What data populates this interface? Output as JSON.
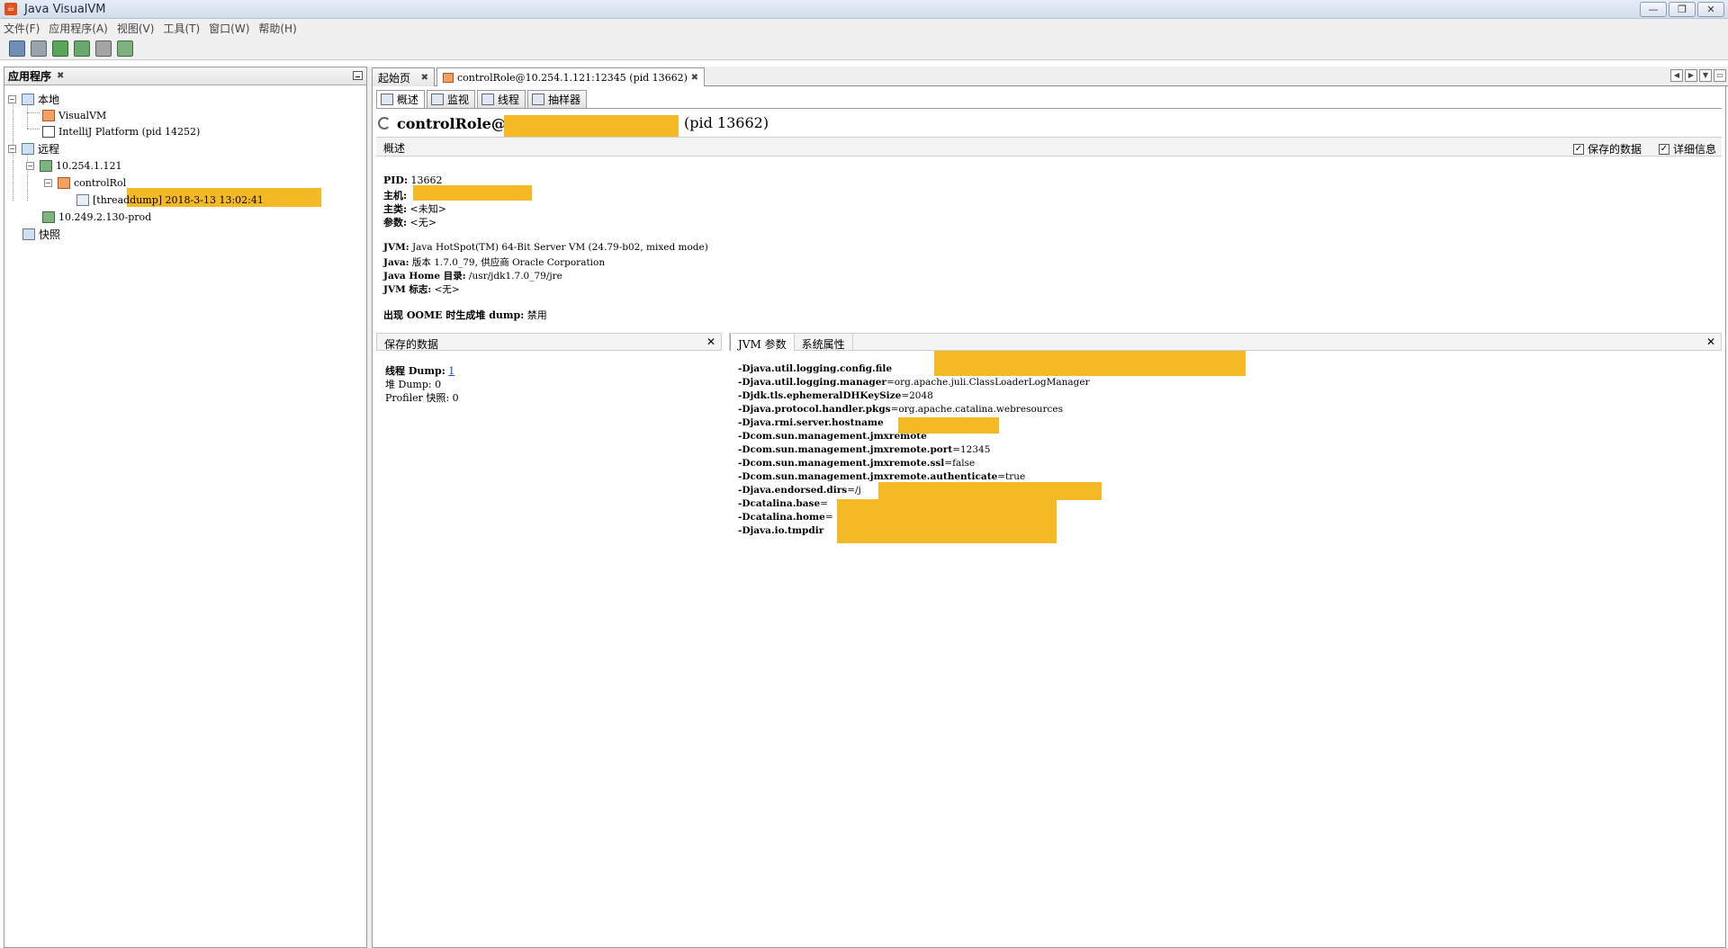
{
  "window": {
    "title": "Java VisualVM",
    "controls": [
      "—",
      "❐",
      "✕"
    ]
  },
  "menu": [
    "文件(F)",
    "应用程序(A)",
    "视图(V)",
    "工具(T)",
    "窗口(W)",
    "帮助(H)"
  ],
  "left_panel": {
    "title": "应用程序",
    "tree": {
      "local": "本地",
      "visualvm": "VisualVM",
      "intellij": "IntelliJ Platform (pid 14252)",
      "remote": "远程",
      "host1": "10.254.1.121",
      "control_role": "controlRol",
      "threaddump": "[threaddump] 2018-3-13 13:02:41",
      "host2": "10.249.2.130-prod",
      "snapshots": "快照"
    }
  },
  "doc_tabs": [
    {
      "label": "起始页"
    },
    {
      "label": "controlRole@10.254.1.121:12345 (pid 13662)"
    }
  ],
  "view_tabs": [
    "概述",
    "监视",
    "线程",
    "抽样器"
  ],
  "overview": {
    "title_prefix": "controlRole@",
    "title_pid": "(pid 13662)",
    "section_title": "概述",
    "checkbox_saved": "保存的数据",
    "checkbox_details": "详细信息",
    "lines": [
      {
        "key": "PID:",
        "value": " 13662"
      },
      {
        "key": "主机:",
        "value": ""
      },
      {
        "key": "主类:",
        "value": " <未知>"
      },
      {
        "key": "参数:",
        "value": " <无>"
      },
      {
        "key": "JVM:",
        "value": " Java HotSpot(TM) 64-Bit Server VM (24.79-b02, mixed mode)"
      },
      {
        "key": "Java:",
        "value": " 版本 1.7.0_79, 供应商 Oracle Corporation"
      },
      {
        "key": "Java Home 目录:",
        "value": " /usr/jdk1.7.0_79/jre"
      },
      {
        "key": "JVM 标志:",
        "value": " <无>"
      },
      {
        "key": "出现 OOME 时生成堆 dump:",
        "value": " 禁用"
      }
    ]
  },
  "saved_data": {
    "header": "保存的数据",
    "thread_dump_label": "线程 Dump:",
    "thread_dump_value": "1",
    "heap_dump": "堆 Dump: 0",
    "profiler": "Profiler 快照: 0"
  },
  "jvm_panel": {
    "tabs": [
      "JVM 参数",
      "系统属性"
    ],
    "args": [
      {
        "k": "-Djava.util.logging.config.file",
        "v": ""
      },
      {
        "k": "-Djava.util.logging.manager",
        "v": "=org.apache.juli.ClassLoaderLogManager"
      },
      {
        "k": "-Djdk.tls.ephemeralDHKeySize",
        "v": "=2048"
      },
      {
        "k": "-Djava.protocol.handler.pkgs",
        "v": "=org.apache.catalina.webresources"
      },
      {
        "k": "-Djava.rmi.server.hostname",
        "v": ""
      },
      {
        "k": "-Dcom.sun.management.jmxremote",
        "v": ""
      },
      {
        "k": "-Dcom.sun.management.jmxremote.port",
        "v": "=12345"
      },
      {
        "k": "-Dcom.sun.management.jmxremote.ssl",
        "v": "=false"
      },
      {
        "k": "-Dcom.sun.management.jmxremote.authenticate",
        "v": "=true"
      },
      {
        "k": "-Djava.endorsed.dirs",
        "v": "=/j"
      },
      {
        "k": "-Dcatalina.base",
        "v": "="
      },
      {
        "k": "-Dcatalina.home",
        "v": "="
      },
      {
        "k": "-Djava.io.tmpdir",
        "v": ""
      }
    ]
  },
  "colors": {
    "redaction": "#f5b925",
    "link": "#1a3fc4"
  }
}
